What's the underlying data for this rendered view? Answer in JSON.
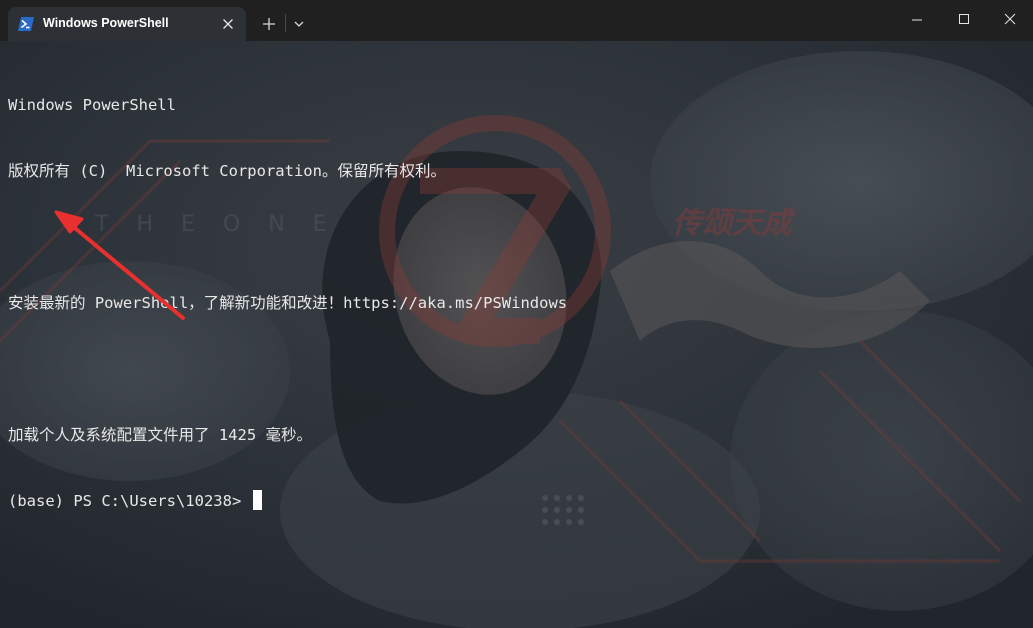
{
  "window": {
    "tab_title": "Windows PowerShell",
    "tab_icon": "powershell-icon",
    "close_tab_icon": "close-icon",
    "new_tab_icon": "plus-icon",
    "dropdown_icon": "chevron-down-icon",
    "minimize_icon": "minimize-icon",
    "maximize_icon": "maximize-icon",
    "close_window_icon": "close-icon"
  },
  "terminal": {
    "lines": [
      "Windows PowerShell",
      "版权所有 (C)  Microsoft Corporation。保留所有权利。",
      "",
      "安装最新的 PowerShell，了解新功能和改进！https://aka.ms/PSWindows",
      "",
      "加载个人及系统配置文件用了 1425 毫秒。"
    ],
    "prompt": "(base) PS C:\\Users\\10238> "
  },
  "background": {
    "watermark_letters": "THEONE",
    "watermark_brand": "传颂天成",
    "logo_color": "#b3473f"
  },
  "annotation": {
    "arrow_color": "#e8302e"
  },
  "colors": {
    "titlebar": "#202020",
    "active_tab": "#2d3034",
    "text": "#e8e8e8"
  }
}
